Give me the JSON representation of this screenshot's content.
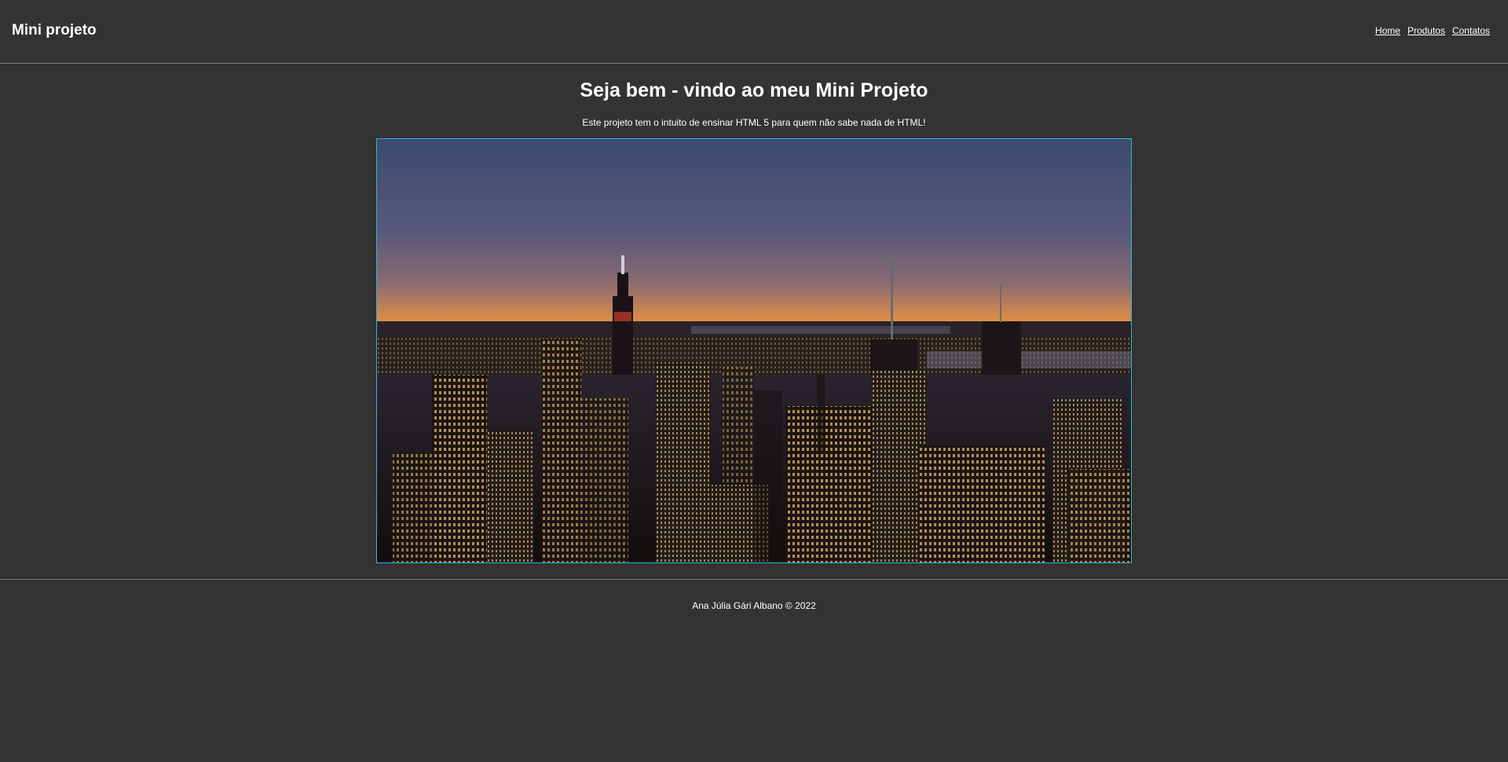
{
  "header": {
    "title": "Mini projeto",
    "nav": [
      {
        "label": "Home"
      },
      {
        "label": "Produtos"
      },
      {
        "label": "Contatos"
      }
    ]
  },
  "main": {
    "title": "Seja bem - vindo ao meu Mini Projeto",
    "subtitle": "Este projeto tem o intuito de ensinar HTML 5 para quem não sabe nada de HTML!",
    "image": {
      "border_color": "#2bb8d8"
    }
  },
  "footer": {
    "text": "Ana Júlia Gári Albano © 2022"
  },
  "colors": {
    "background": "#333333",
    "text": "#ffffff",
    "divider": "#7a7a7a"
  }
}
